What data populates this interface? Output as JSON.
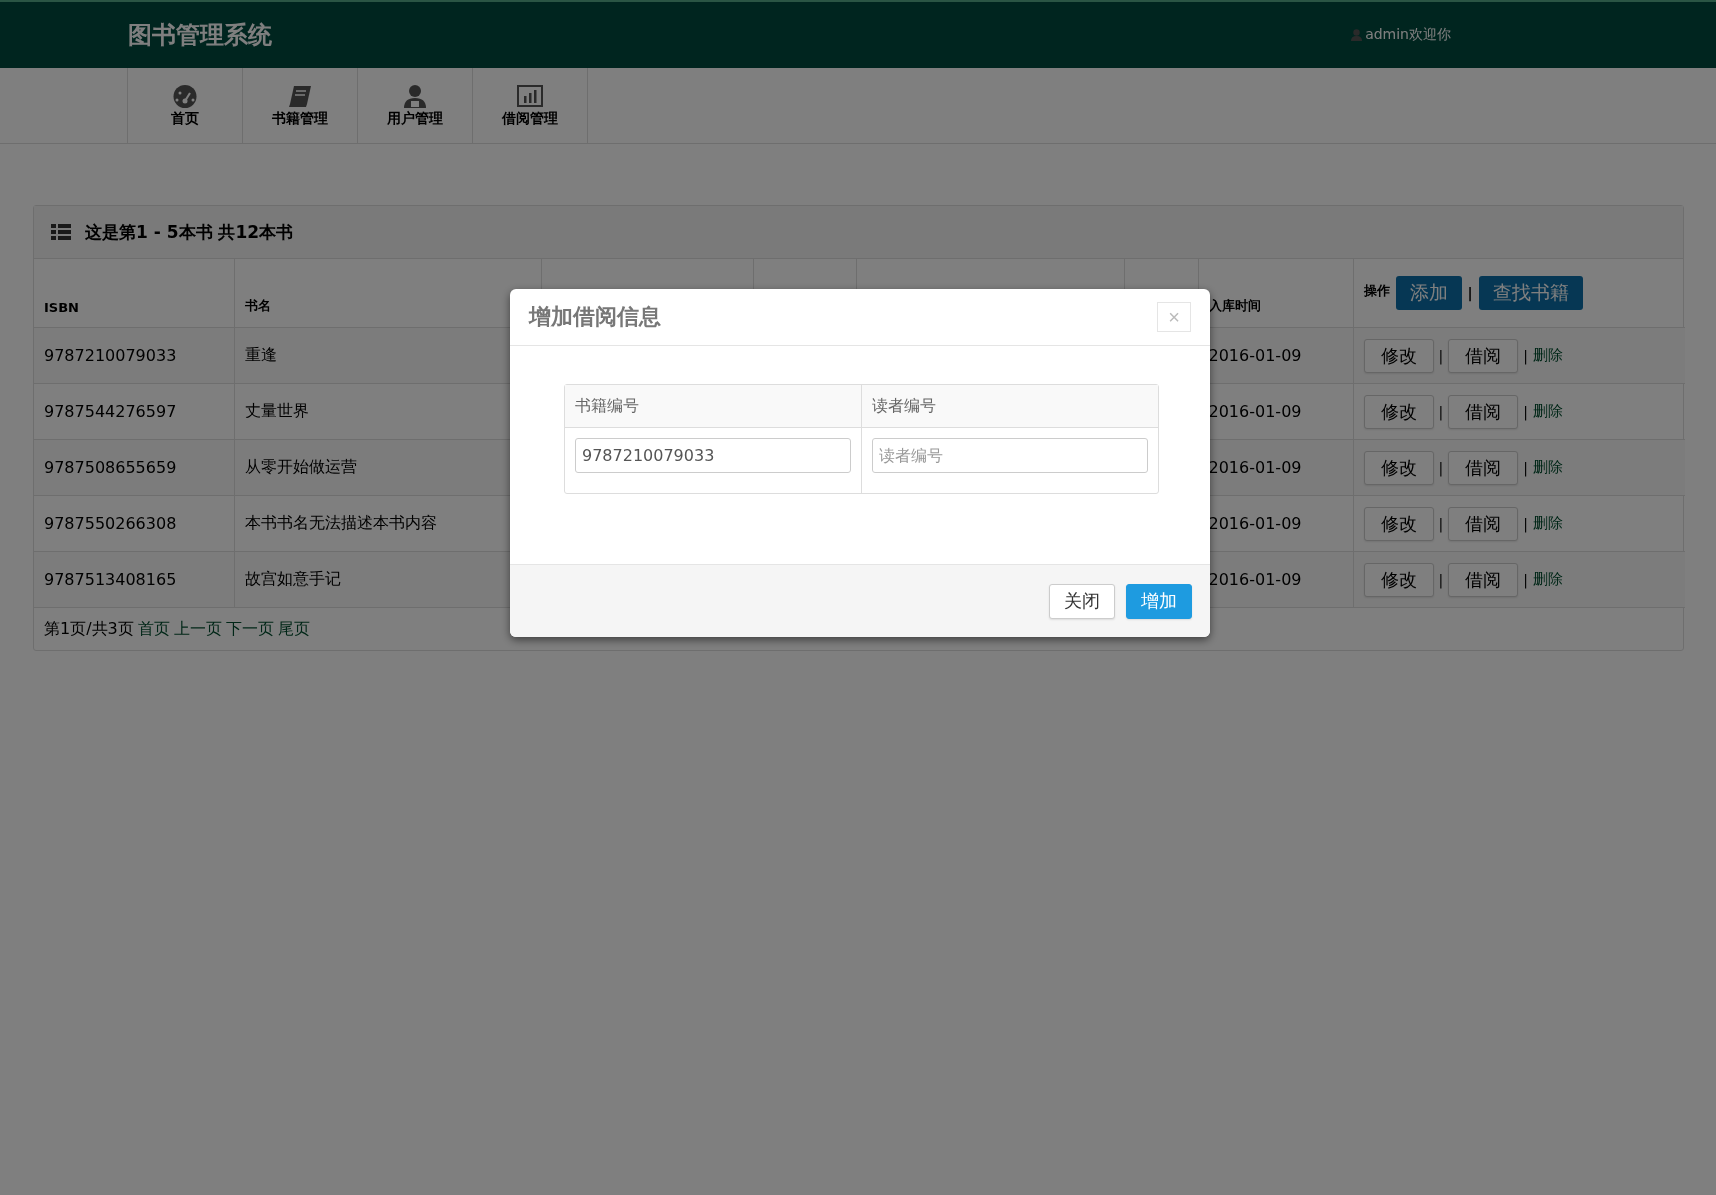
{
  "header": {
    "brand": "图书管理系统",
    "user": "admin欢迎你"
  },
  "nav": [
    {
      "label": "首页"
    },
    {
      "label": "书籍管理"
    },
    {
      "label": "用户管理"
    },
    {
      "label": "借阅管理"
    }
  ],
  "panel": {
    "title": "这是第1 - 5本书 共12本书",
    "columns": [
      "ISBN",
      "书名",
      "入库时间",
      "操作"
    ],
    "header_actions": [
      {
        "kind": "button",
        "label": "添加"
      },
      {
        "kind": "separator",
        "label": "|"
      },
      {
        "kind": "button",
        "label": "查找书籍"
      }
    ],
    "rows": [
      {
        "isbn": "9787210079033",
        "title": "重逢",
        "date": "2016-01-09",
        "actions": [
          {
            "kind": "button",
            "label": "修改"
          },
          {
            "kind": "separator",
            "label": "|"
          },
          {
            "kind": "button",
            "label": "借阅"
          },
          {
            "kind": "separator",
            "label": "|"
          },
          {
            "kind": "link",
            "label": "删除"
          }
        ]
      },
      {
        "isbn": "9787544276597",
        "title": "丈量世界",
        "date": "2016-01-09",
        "actions": [
          {
            "kind": "button",
            "label": "修改"
          },
          {
            "kind": "separator",
            "label": "|"
          },
          {
            "kind": "button",
            "label": "借阅"
          },
          {
            "kind": "separator",
            "label": "|"
          },
          {
            "kind": "link",
            "label": "删除"
          }
        ]
      },
      {
        "isbn": "9787508655659",
        "title": "从零开始做运营",
        "date": "2016-01-09",
        "actions": [
          {
            "kind": "button",
            "label": "修改"
          },
          {
            "kind": "separator",
            "label": "|"
          },
          {
            "kind": "button",
            "label": "借阅"
          },
          {
            "kind": "separator",
            "label": "|"
          },
          {
            "kind": "link",
            "label": "删除"
          }
        ]
      },
      {
        "isbn": "9787550266308",
        "title": "本书书名无法描述本书内容",
        "date": "2016-01-09",
        "actions": [
          {
            "kind": "button",
            "label": "修改"
          },
          {
            "kind": "separator",
            "label": "|"
          },
          {
            "kind": "button",
            "label": "借阅"
          },
          {
            "kind": "separator",
            "label": "|"
          },
          {
            "kind": "link",
            "label": "删除"
          }
        ]
      },
      {
        "isbn": "9787513408165",
        "title": "故宫如意手记",
        "date": "2016-01-09",
        "actions": [
          {
            "kind": "button",
            "label": "修改"
          },
          {
            "kind": "separator",
            "label": "|"
          },
          {
            "kind": "button",
            "label": "借阅"
          },
          {
            "kind": "separator",
            "label": "|"
          },
          {
            "kind": "link",
            "label": "删除"
          }
        ]
      }
    ],
    "pagination": {
      "status": "第1页/共3页",
      "links": [
        "首页",
        "上一页",
        "下一页",
        "尾页"
      ]
    }
  },
  "modal": {
    "title": "增加借阅信息",
    "close": "×",
    "fields": [
      {
        "label": "书籍编号",
        "value": "9787210079033"
      },
      {
        "label": "读者编号",
        "placeholder": "读者编号"
      }
    ],
    "buttons": [
      {
        "label": "关闭",
        "kind": "default"
      },
      {
        "label": "增加",
        "kind": "primary"
      }
    ]
  }
}
